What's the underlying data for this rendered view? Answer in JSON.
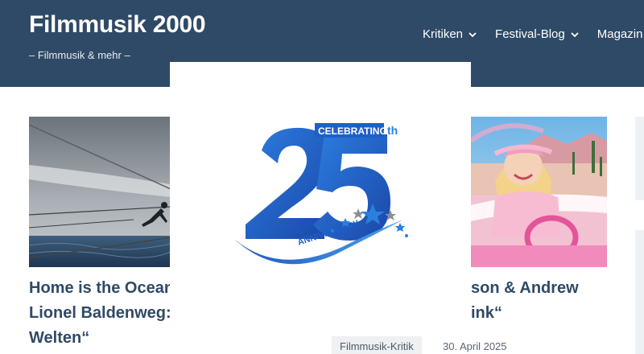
{
  "header": {
    "title": "Filmmusik 2000",
    "tagline": "– Filmmusik & mehr –",
    "bg_color": "#2f4a66"
  },
  "nav": {
    "items": [
      {
        "label": "Kritiken",
        "icon": "chevron-down-icon"
      },
      {
        "label": "Festival-Blog",
        "icon": "chevron-down-icon"
      },
      {
        "label": "Magazin",
        "icon": ""
      }
    ]
  },
  "posts": {
    "left": {
      "title_lines": [
        "Home is the Ocean",
        "Lionel Baldenweg:",
        "Welten“"
      ],
      "image": "sailing-photo"
    },
    "right": {
      "title_lines": [
        "son & Andrew",
        "ink“"
      ],
      "image": "barbie-car-photo"
    }
  },
  "meta": {
    "category": "Filmmusik-Kritik",
    "date": "30. April 2025"
  },
  "popup": {
    "badge_text": "CELEBRATING",
    "superscript": "th",
    "number": "25",
    "ribbon_text": "ANNIVERSARY",
    "accent_color": "#1f5fc8"
  }
}
